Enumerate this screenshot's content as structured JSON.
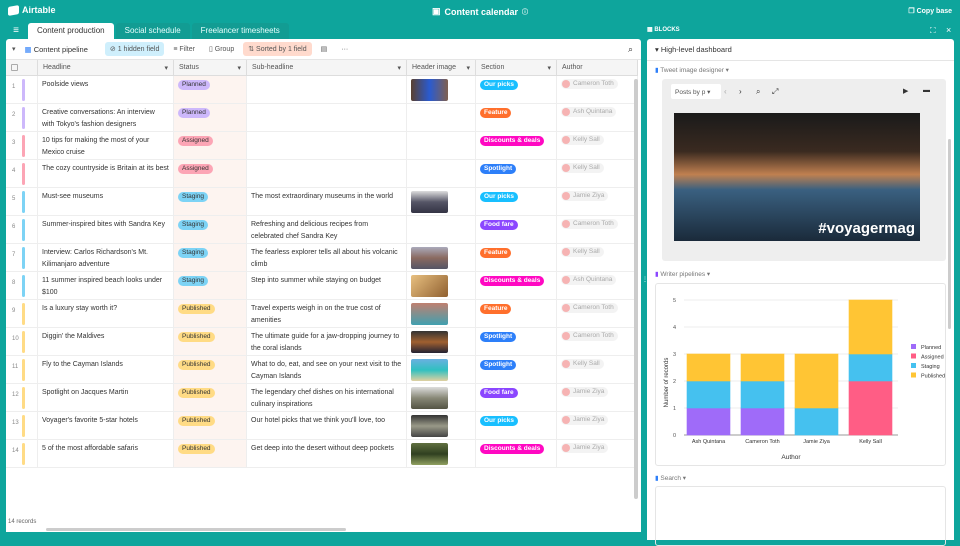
{
  "app": {
    "name": "Airtable",
    "base_title": "Content calendar",
    "copy_base": "Copy base"
  },
  "tabs": [
    "Content production",
    "Social schedule",
    "Freelancer timesheets"
  ],
  "toolbar": {
    "view": "Content pipeline",
    "hidden": "1 hidden field",
    "filter": "Filter",
    "group": "Group",
    "sorted": "Sorted by 1 field",
    "more": "···"
  },
  "columns": [
    "Headline",
    "Status",
    "Sub-headline",
    "Header image",
    "Section",
    "Author"
  ],
  "status_colors": {
    "Planned": "#cdb8fb",
    "Assigned": "#fca5b5",
    "Staging": "#7dd3f5",
    "Published": "#ffdb85"
  },
  "section_colors": {
    "Our picks": "#18bfff",
    "Feature": "#ff6f2c",
    "Discounts & deals": "#ff08c2",
    "Spotlight": "#2d7ff9",
    "Food fare": "#8b46ff"
  },
  "rows": [
    {
      "n": "1",
      "headline": "Poolside views",
      "status": "Planned",
      "sub": "",
      "img": "linear-gradient(90deg,#5a4030,#2a5bd0,#806050)",
      "section": "Our picks",
      "author": "Cameron Toth"
    },
    {
      "n": "2",
      "headline": "Creative conversations: An interview with Tokyo's fashion designers",
      "status": "Planned",
      "sub": "",
      "img": "",
      "section": "Feature",
      "author": "Ash Quintana"
    },
    {
      "n": "3",
      "headline": "10 tips for making the most of your Mexico cruise",
      "status": "Assigned",
      "sub": "",
      "img": "",
      "section": "Discounts & deals",
      "author": "Kelly Sall"
    },
    {
      "n": "4",
      "headline": "The cozy countryside is Britain at its best",
      "status": "Assigned",
      "sub": "",
      "img": "",
      "section": "Spotlight",
      "author": "Kelly Sall"
    },
    {
      "n": "5",
      "headline": "Must-see museums",
      "status": "Staging",
      "sub": "The most extraordinary museums in the world",
      "img": "linear-gradient(180deg,#ddd,#556,#334)",
      "section": "Our picks",
      "author": "Jamie Ziya"
    },
    {
      "n": "6",
      "headline": "Summer-inspired bites with Sandra Key",
      "status": "Staging",
      "sub": "Refreshing and delicious recipes from celebrated chef Sandra Key",
      "img": "",
      "section": "Food fare",
      "author": "Cameron Toth"
    },
    {
      "n": "7",
      "headline": "Interview: Carlos Richardson's Mt. Kilimanjaro adventure",
      "status": "Staging",
      "sub": "The fearless explorer tells all about his volcanic climb",
      "img": "linear-gradient(180deg,#aab,#8a6a60,#556)",
      "section": "Feature",
      "author": "Kelly Sall"
    },
    {
      "n": "8",
      "headline": "11 summer inspired beach looks under $100",
      "status": "Staging",
      "sub": "Step into summer while staying on budget",
      "img": "linear-gradient(135deg,#e8c080,#906030)",
      "section": "Discounts & deals",
      "author": "Ash Quintana"
    },
    {
      "n": "9",
      "headline": "Is a luxury stay worth it?",
      "status": "Published",
      "sub": "Travel experts weigh in on the true cost of amenities",
      "img": "linear-gradient(180deg,#c08070,#40a0b0)",
      "section": "Feature",
      "author": "Cameron Toth"
    },
    {
      "n": "10",
      "headline": "Diggin' the Maldives",
      "status": "Published",
      "sub": "The ultimate guide for a jaw-dropping journey to the coral islands",
      "img": "linear-gradient(180deg,#333,#a06030,#223)",
      "section": "Spotlight",
      "author": "Cameron Toth"
    },
    {
      "n": "11",
      "headline": "Fly to the Cayman Islands",
      "status": "Published",
      "sub": "What to do, eat, and see on your next visit to the Cayman Islands",
      "img": "linear-gradient(180deg,#6ab0e0,#30c0c0,#e0d0a0)",
      "section": "Spotlight",
      "author": "Kelly Sall"
    },
    {
      "n": "12",
      "headline": "Spotlight on Jacques Martin",
      "status": "Published",
      "sub": "The legendary chef dishes on his international culinary inspirations",
      "img": "linear-gradient(180deg,#ddd,#887,#554)",
      "section": "Food fare",
      "author": "Jamie Ziya"
    },
    {
      "n": "13",
      "headline": "Voyager's favorite 5-star hotels",
      "status": "Published",
      "sub": "Our hotel picks that we think you'll love, too",
      "img": "linear-gradient(180deg,#333,#998,#444)",
      "section": "Our picks",
      "author": "Jamie Ziya"
    },
    {
      "n": "14",
      "headline": "5 of the most affordable safaris",
      "status": "Published",
      "sub": "Get deep into the desert without deep pockets",
      "img": "linear-gradient(180deg,#607040,#304020,#90a060)",
      "section": "Discounts & deals",
      "author": "Jamie Ziya"
    }
  ],
  "footer": "14 records",
  "blocks": {
    "label": "BLOCKS",
    "dashboard": "High-level dashboard",
    "tweet_block": "Tweet image designer",
    "posts_select": "Posts by p",
    "hashtag": "#voyagermag",
    "chart_block": "Writer pipelines",
    "search_block": "Search"
  },
  "chart_data": {
    "type": "bar",
    "stacked": true,
    "categories": [
      "Ash Quintana",
      "Cameron Toth",
      "Jamie Ziya",
      "Kelly Sall"
    ],
    "series": [
      {
        "name": "Planned",
        "color": "#9f6bf9",
        "values": [
          1,
          1,
          0,
          0
        ]
      },
      {
        "name": "Assigned",
        "color": "#ff5d85",
        "values": [
          0,
          0,
          0,
          2
        ]
      },
      {
        "name": "Staging",
        "color": "#45c1ef",
        "values": [
          1,
          1,
          1,
          1
        ]
      },
      {
        "name": "Published",
        "color": "#ffc534",
        "values": [
          1,
          1,
          2,
          2
        ]
      }
    ],
    "xlabel": "Author",
    "ylabel": "Number of records",
    "ylim": [
      0,
      5
    ],
    "yticks": [
      "0",
      "1",
      "2",
      "3",
      "4",
      "5"
    ],
    "legend": "right",
    "grid": true
  }
}
